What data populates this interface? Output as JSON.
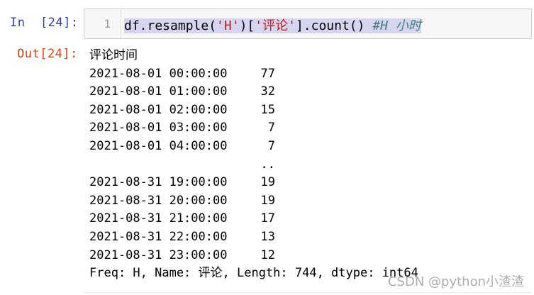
{
  "input_cell": {
    "prompt": "In  [24]:",
    "line_number": "1",
    "code": {
      "part1": "df.resample(",
      "str1": "'H'",
      "part2": ")[",
      "str2": "'评论'",
      "part3": "].count() ",
      "comment": "#H 小时"
    }
  },
  "output_cell": {
    "prompt": "Out[24]:",
    "header": "评论时间",
    "rows": [
      {
        "index": "2021-08-01 00:00:00",
        "value": "77"
      },
      {
        "index": "2021-08-01 01:00:00",
        "value": "32"
      },
      {
        "index": "2021-08-01 02:00:00",
        "value": "15"
      },
      {
        "index": "2021-08-01 03:00:00",
        "value": "7"
      },
      {
        "index": "2021-08-01 04:00:00",
        "value": "7"
      },
      {
        "index": "",
        "value": ".."
      },
      {
        "index": "2021-08-31 19:00:00",
        "value": "19"
      },
      {
        "index": "2021-08-31 20:00:00",
        "value": "19"
      },
      {
        "index": "2021-08-31 21:00:00",
        "value": "17"
      },
      {
        "index": "2021-08-31 22:00:00",
        "value": "13"
      },
      {
        "index": "2021-08-31 23:00:00",
        "value": "12"
      }
    ],
    "footer": "Freq: H, Name: 评论, Length: 744, dtype: int64"
  },
  "watermark": "CSDN @python小渣渣"
}
